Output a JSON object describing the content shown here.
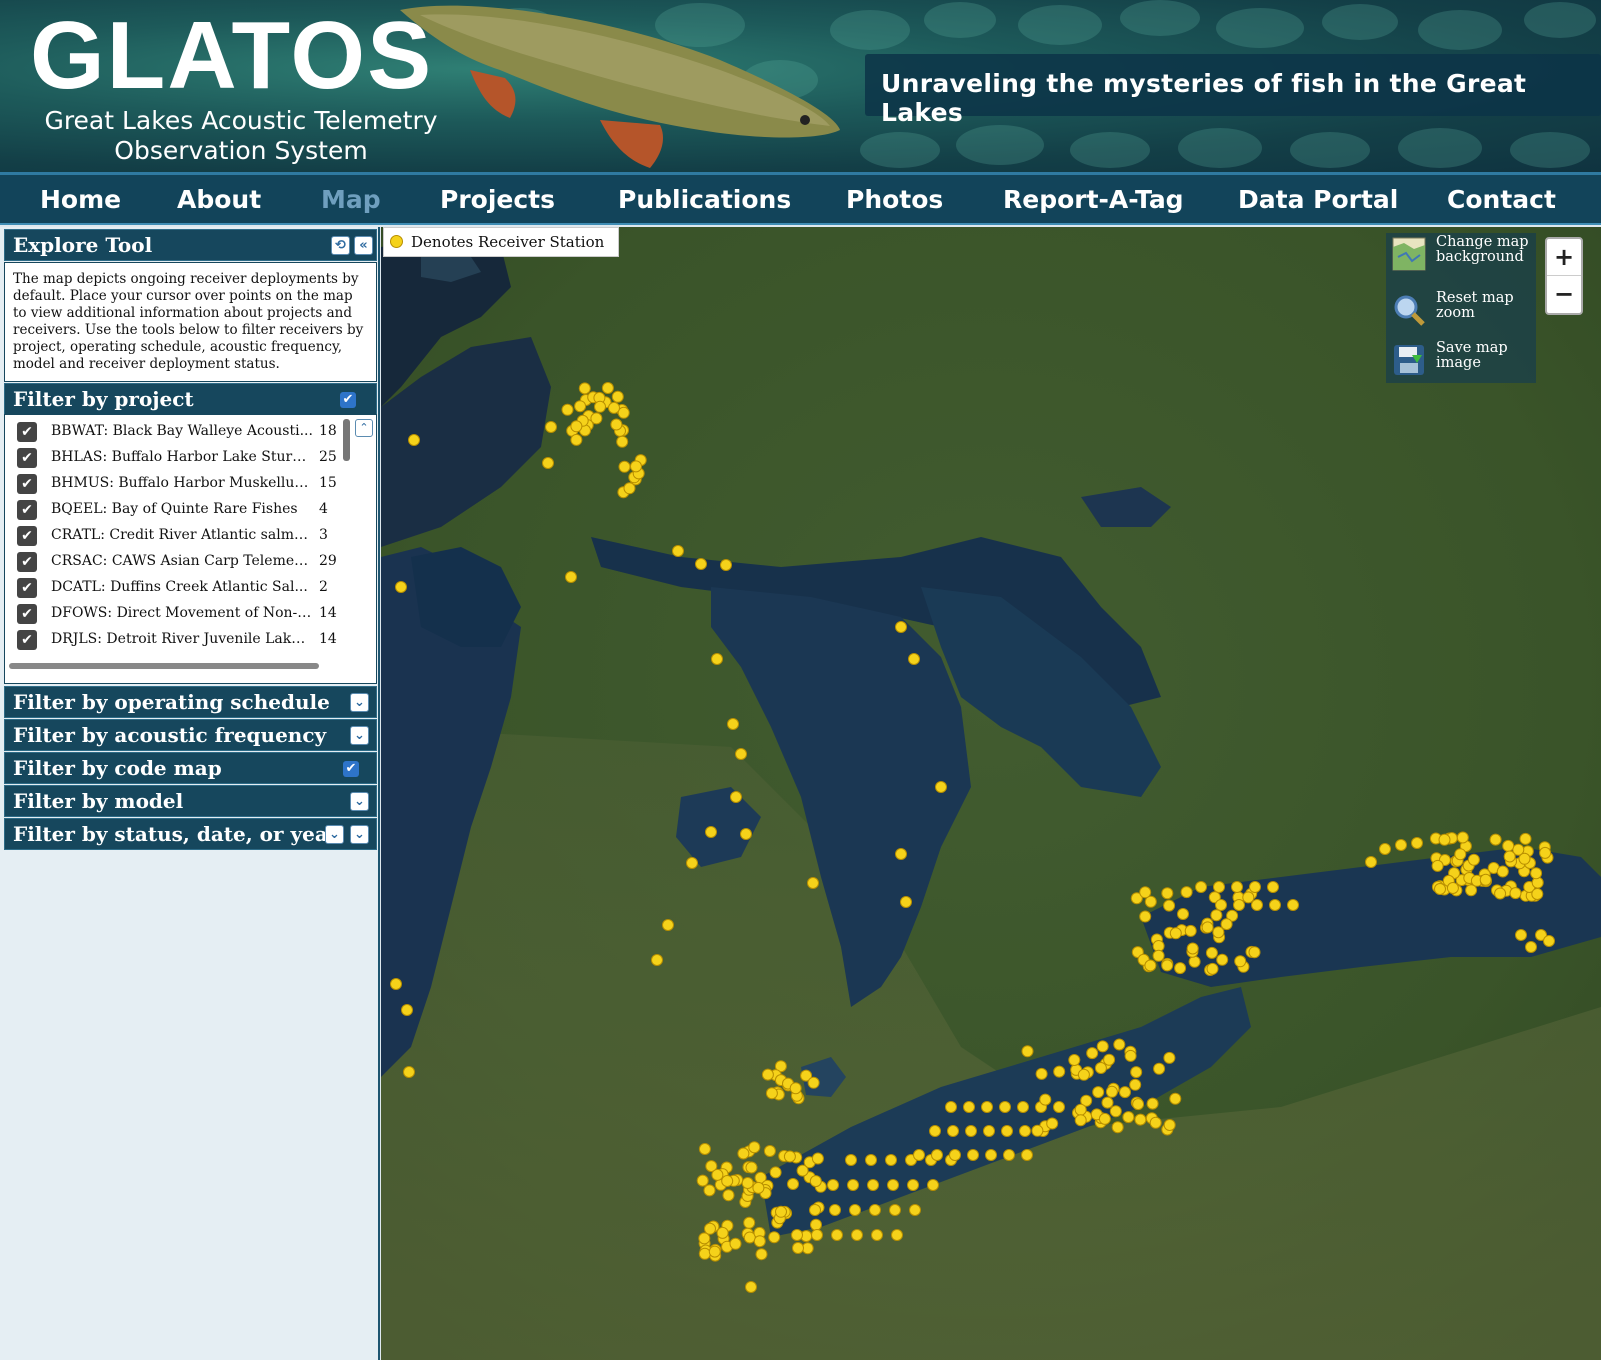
{
  "header": {
    "logo_text": "GLATOS",
    "logo_subtitle_line1": "Great Lakes Acoustic Telemetry",
    "logo_subtitle_line2": "Observation System",
    "tagline": "Unraveling the mysteries of fish in the Great Lakes"
  },
  "nav": {
    "items": [
      {
        "label": "Home",
        "active": false
      },
      {
        "label": "About",
        "active": false
      },
      {
        "label": "Map",
        "active": true
      },
      {
        "label": "Projects",
        "active": false
      },
      {
        "label": "Publications",
        "active": false
      },
      {
        "label": "Photos",
        "active": false
      },
      {
        "label": "Report-A-Tag",
        "active": false
      },
      {
        "label": "Data Portal",
        "active": false
      },
      {
        "label": "Contact",
        "active": false
      }
    ]
  },
  "sidebar": {
    "explore_title": "Explore Tool",
    "description": "The map depicts ongoing receiver deployments by default. Place your cursor over points on the map to view additional information about projects and receivers. Use the tools below to filter receivers by project, operating schedule, acoustic frequency, model and receiver deployment status.",
    "filter_project_title": "Filter by project",
    "projects": [
      {
        "label": "BBWAT: Black Bay Walleye Acousti...",
        "count": "18"
      },
      {
        "label": "BHLAS: Buffalo Harbor Lake Sturg...",
        "count": "25"
      },
      {
        "label": "BHMUS: Buffalo Harbor Muskellunge",
        "count": "15"
      },
      {
        "label": "BQEEL: Bay of Quinte Rare Fishes",
        "count": "4"
      },
      {
        "label": "CRATL: Credit River Atlantic salmo...",
        "count": "3"
      },
      {
        "label": "CRSAC: CAWS Asian Carp Telemetry",
        "count": "29"
      },
      {
        "label": "DCATL: Duffins Creek Atlantic Sal...",
        "count": "2"
      },
      {
        "label": "DFOWS: Direct Movement of Non-i...",
        "count": "14"
      },
      {
        "label": "DRJLS: Detroit River Juvenile Lake ...",
        "count": "14"
      }
    ],
    "filters": [
      {
        "label": "Filter by operating schedule",
        "control": "expand"
      },
      {
        "label": "Filter by acoustic frequency",
        "control": "expand"
      },
      {
        "label": "Filter by code map",
        "control": "checked"
      },
      {
        "label": "Filter by model",
        "control": "expand"
      },
      {
        "label": "Filter by status, date, or year",
        "control": "expand"
      }
    ]
  },
  "map": {
    "legend_label": "Denotes Receiver Station",
    "tools": [
      {
        "label": "Change map background",
        "icon": "map-background-icon"
      },
      {
        "label": "Reset map zoom",
        "icon": "zoom-reset-icon"
      },
      {
        "label": "Save map image",
        "icon": "save-disk-icon"
      }
    ],
    "zoom_in": "+",
    "zoom_out": "−",
    "receiver_color": "#f5d21a"
  },
  "colors": {
    "nav_bg": "#12445a",
    "panel_head_bg": "#16475d",
    "active_nav": "#6f9fbe"
  }
}
